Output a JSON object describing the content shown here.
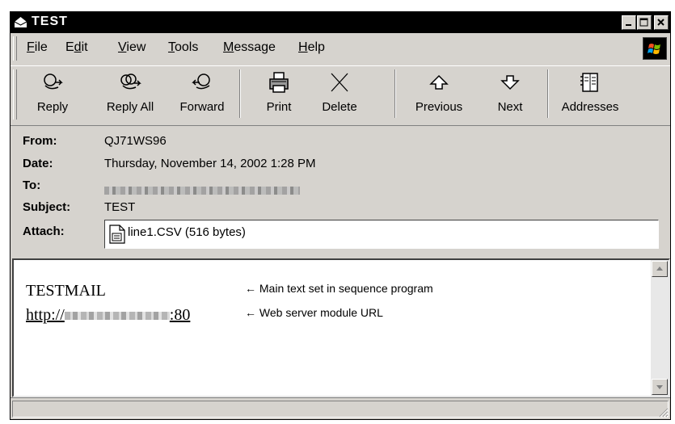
{
  "window": {
    "title": "TEST"
  },
  "menu": [
    {
      "label": "File",
      "underline": "F"
    },
    {
      "label": "Edit",
      "underline": "d"
    },
    {
      "label": "View",
      "underline": "V"
    },
    {
      "label": "Tools",
      "underline": "T"
    },
    {
      "label": "Message",
      "underline": "M"
    },
    {
      "label": "Help",
      "underline": "H"
    }
  ],
  "toolbar": {
    "reply": "Reply",
    "reply_all": "Reply All",
    "forward": "Forward",
    "print": "Print",
    "delete": "Delete",
    "previous": "Previous",
    "next": "Next",
    "addresses": "Addresses"
  },
  "header": {
    "from_label": "From:",
    "from_value": "QJ71WS96",
    "date_label": "Date:",
    "date_value": "Thursday, November 14, 2002 1:28 PM",
    "to_label": "To:",
    "subject_label": "Subject:",
    "subject_value": "TEST",
    "attach_label": "Attach:",
    "attach_value": "line1.CSV (516 bytes)"
  },
  "body": {
    "main_text": "TESTMAIL",
    "url_prefix": "http://",
    "url_suffix": ":80",
    "annotation_main": "← Main text set in sequence program",
    "annotation_url": "← Web server module URL"
  },
  "icons": {
    "title": "envelope-icon",
    "reply": "reply-icon",
    "reply_all": "reply-all-icon",
    "forward": "forward-icon",
    "print": "printer-icon",
    "delete": "delete-x-icon",
    "previous": "up-arrow-icon",
    "next": "down-arrow-icon",
    "addresses": "address-book-icon"
  }
}
